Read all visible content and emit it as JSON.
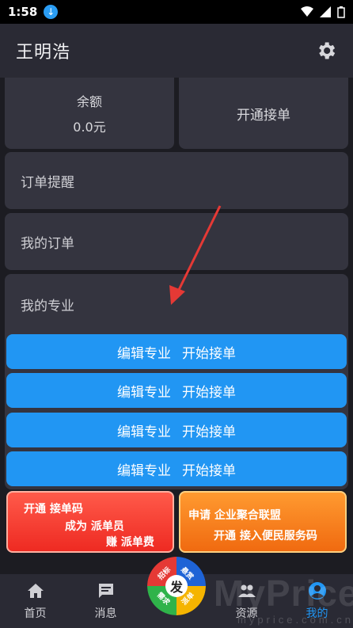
{
  "status_bar": {
    "time": "1:58"
  },
  "app_bar": {
    "title": "王明浩"
  },
  "balance": {
    "label": "余额",
    "value": "0.0元"
  },
  "open_order": {
    "label": "开通接单"
  },
  "menu": {
    "order_reminder": "订单提醒",
    "my_orders": "我的订单",
    "my_specialty": "我的专业"
  },
  "specialty_buttons": [
    {
      "edit": "编辑专业",
      "start": "开始接单"
    },
    {
      "edit": "编辑专业",
      "start": "开始接单"
    },
    {
      "edit": "编辑专业",
      "start": "开始接单"
    },
    {
      "edit": "编辑专业",
      "start": "开始接单"
    }
  ],
  "promo_left": {
    "line1": "开通 接单码",
    "line2": "成为 派单员",
    "line3": "赚 派单费"
  },
  "promo_right": {
    "line1": "申请 企业聚合联盟",
    "line2": "开通 接入便民服务码"
  },
  "fab": {
    "center": "发",
    "q1": "招标",
    "q2": "悬赏",
    "q3": "需求",
    "q4": "派单"
  },
  "tabs": [
    {
      "label": "首页",
      "icon": "home-icon"
    },
    {
      "label": "消息",
      "icon": "message-icon"
    },
    {
      "label": "",
      "icon": ""
    },
    {
      "label": "资源",
      "icon": "people-icon"
    },
    {
      "label": "我的",
      "icon": "profile-icon"
    }
  ],
  "watermark": {
    "main": "MyPrice",
    "sub": "myprice.com.cn"
  },
  "colors": {
    "accent": "#2196f3",
    "background": "#1c1c22",
    "card": "#34343f"
  }
}
